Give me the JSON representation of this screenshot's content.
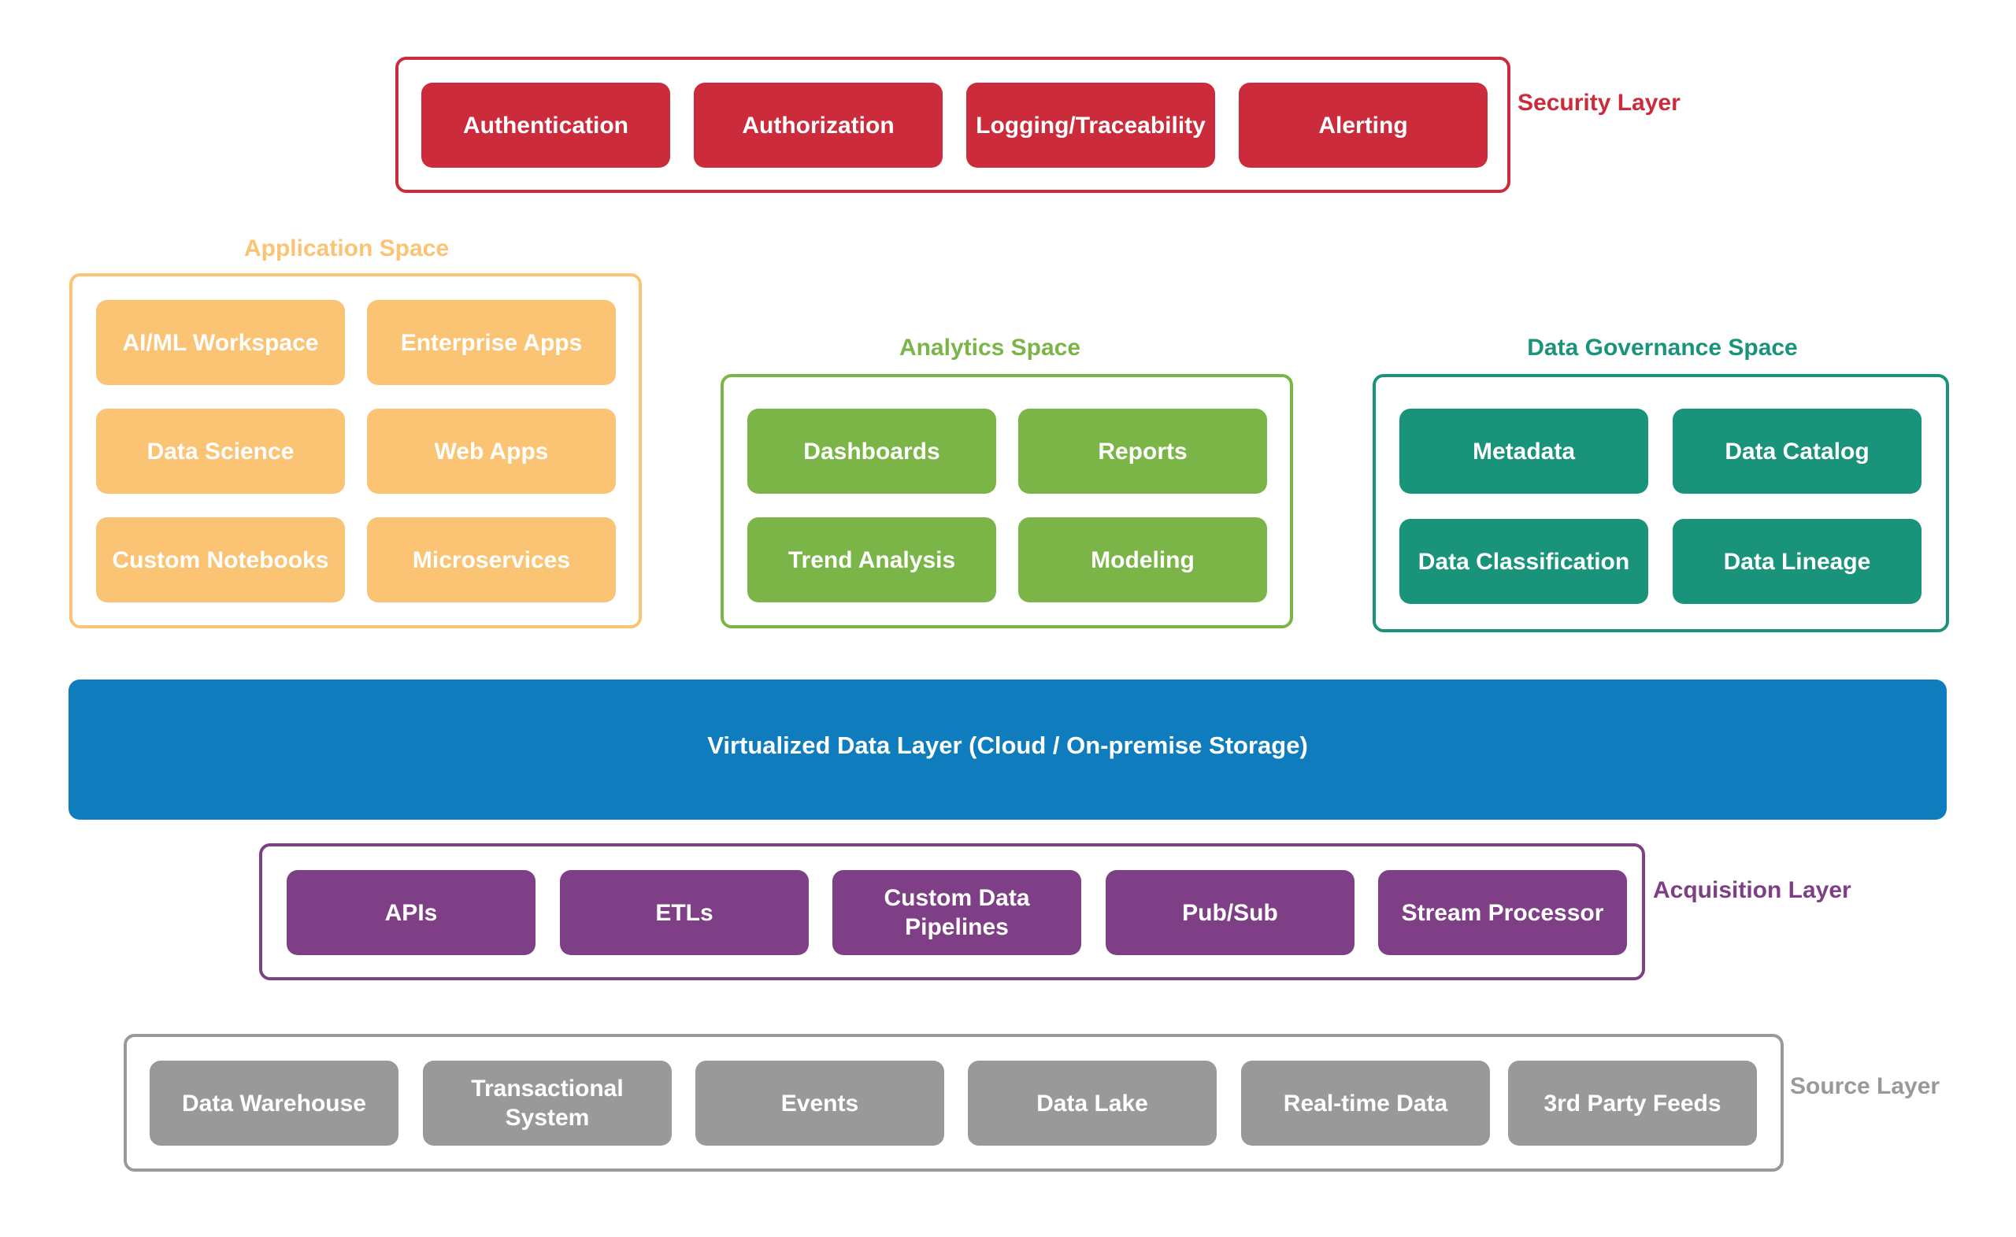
{
  "security": {
    "label": "Security Layer",
    "color": "#cc2b3b",
    "items": [
      "Authentication",
      "Authorization",
      "Logging/Traceability",
      "Alerting"
    ]
  },
  "application": {
    "title": "Application Space",
    "color": "#fbc374",
    "items": [
      "AI/ML Workspace",
      "Enterprise Apps",
      "Data Science",
      "Web Apps",
      "Custom Notebooks",
      "Microservices"
    ]
  },
  "analytics": {
    "title": "Analytics Space",
    "color": "#7bb548",
    "items": [
      "Dashboards",
      "Reports",
      "Trend Analysis",
      "Modeling"
    ]
  },
  "governance": {
    "title": "Data Governance Space",
    "color": "#1a937b",
    "items": [
      "Metadata",
      "Data Catalog",
      "Data Classification",
      "Data Lineage"
    ]
  },
  "virtualized": {
    "label": "Virtualized Data Layer (Cloud / On-premise Storage)",
    "color": "#0f7dbd"
  },
  "acquisition": {
    "label": "Acquisition Layer",
    "color": "#7f3f86",
    "items": [
      "APIs",
      "ETLs",
      "Custom Data\nPipelines",
      "Pub/Sub",
      "Stream Processor"
    ]
  },
  "source": {
    "label": "Source Layer",
    "color": "#999999",
    "items": [
      "Data Warehouse",
      "Transactional\nSystem",
      "Events",
      "Data Lake",
      "Real-time Data",
      "3rd Party Feeds"
    ]
  }
}
